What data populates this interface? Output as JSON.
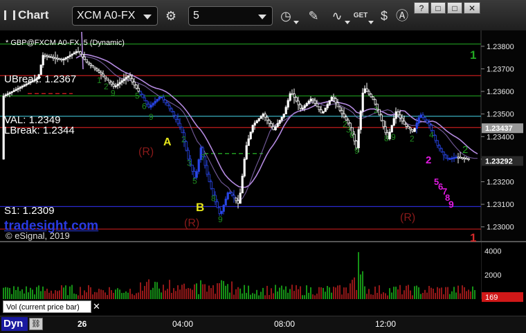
{
  "app": {
    "title": "Chart",
    "symbol": "XCM A0-FX",
    "interval": "5",
    "window_buttons": [
      "?",
      "□",
      "□",
      "✕"
    ]
  },
  "toolbar_icons": [
    "settings-icon",
    "clock-icon",
    "pencil-icon",
    "study-icon",
    "get-icon",
    "dollar-icon",
    "a-icon"
  ],
  "chart_header": "* GBP@FXCM A0-FX, 5 (Dynamic)",
  "watermark": {
    "site": "tradesight.com",
    "copyright": "© eSignal, 2019"
  },
  "chart_data": {
    "type": "candlestick",
    "price_axis": {
      "min": 1.2295,
      "max": 1.2387,
      "ticks": [
        "1.23800",
        "1.23700",
        "1.23600",
        "1.23500",
        "1.23400",
        "1.23300",
        "1.23200",
        "1.23100",
        "1.23000"
      ]
    },
    "current_price_badges": [
      {
        "label": "1.23437",
        "value": 1.23437,
        "color": "#9a9a9a"
      },
      {
        "label": "1.23292",
        "value": 1.23292,
        "color": "#2a2a2a"
      }
    ],
    "time_axis": [
      "26",
      "04:00",
      "08:00",
      "12:00"
    ],
    "levels": [
      {
        "value": 1.2381,
        "color": "#1f9a1f",
        "label": "1",
        "label_color": "#22a822"
      },
      {
        "value": 1.2367,
        "color": "#c21d1d",
        "label": "UBreak: 1.2367"
      },
      {
        "value": 1.2358,
        "color": "#1f9a1f"
      },
      {
        "value": 1.2349,
        "color": "#3fc3d6",
        "label": "VAL: 1.2349"
      },
      {
        "value": 1.2344,
        "color": "#c21d1d",
        "label": "LBreak: 1.2344"
      },
      {
        "value": 1.2309,
        "color": "#2a2ad0",
        "label": "S1: 1.2309"
      },
      {
        "value": 1.2299,
        "color": "#c21d1d",
        "label": "1",
        "label_color": "#d42a2a"
      }
    ],
    "annotations": [
      {
        "text": "(R)",
        "color": "#8a1a1a"
      },
      {
        "text": "A",
        "color": "#e5e51a"
      },
      {
        "text": "B",
        "color": "#e5e51a"
      },
      {
        "text": "(R)",
        "color": "#8a1a1a"
      },
      {
        "text": "(R)",
        "color": "#8a1a1a"
      }
    ],
    "td_labels_magenta": [
      "2",
      "5",
      "6",
      "7",
      "8",
      "9"
    ],
    "right_counts": [
      {
        "text": "2",
        "color": "#1fa01f"
      }
    ],
    "volume": {
      "ticks": [
        "4000",
        "2000"
      ],
      "current_label": "169",
      "current_value": 169,
      "indicator_label": "Vol (current price bar)",
      "max": 4600
    }
  },
  "status_bar": {
    "mode": "Dyn",
    "icon": "link-icon"
  }
}
